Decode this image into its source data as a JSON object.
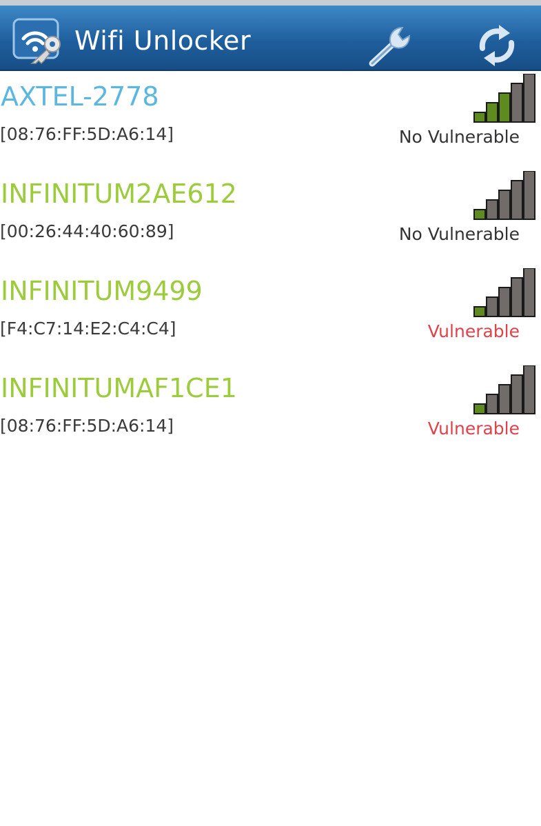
{
  "app": {
    "title": "Wifi Unlocker",
    "icon": "wifi-key-icon",
    "bar_color": "#1f5f9e"
  },
  "actions": {
    "settings_icon": "wrench-icon",
    "refresh_icon": "refresh-icon"
  },
  "colors": {
    "ssid_blue": "#5bb7e0",
    "ssid_green": "#9ccb3c",
    "status_safe": "#333333",
    "status_vulnerable": "#e0424c",
    "signal_on": "#5e8b1f",
    "signal_off": "#716c69"
  },
  "networks": [
    {
      "ssid": "AXTEL-2778",
      "bssid": "[08:76:FF:5D:A6:14]",
      "status": "No Vulnerable",
      "vulnerable": false,
      "ssid_color": "#5bb7e0",
      "signal_level": 3,
      "signal_max": 5
    },
    {
      "ssid": "INFINITUM2AE612",
      "bssid": "[00:26:44:40:60:89]",
      "status": "No Vulnerable",
      "vulnerable": false,
      "ssid_color": "#9ccb3c",
      "signal_level": 1,
      "signal_max": 5
    },
    {
      "ssid": "INFINITUM9499",
      "bssid": "[F4:C7:14:E2:C4:C4]",
      "status": "Vulnerable",
      "vulnerable": true,
      "ssid_color": "#9ccb3c",
      "signal_level": 1,
      "signal_max": 5
    },
    {
      "ssid": "INFINITUMAF1CE1",
      "bssid": "[08:76:FF:5D:A6:14]",
      "status": "Vulnerable",
      "vulnerable": true,
      "ssid_color": "#9ccb3c",
      "signal_level": 1,
      "signal_max": 5
    }
  ]
}
